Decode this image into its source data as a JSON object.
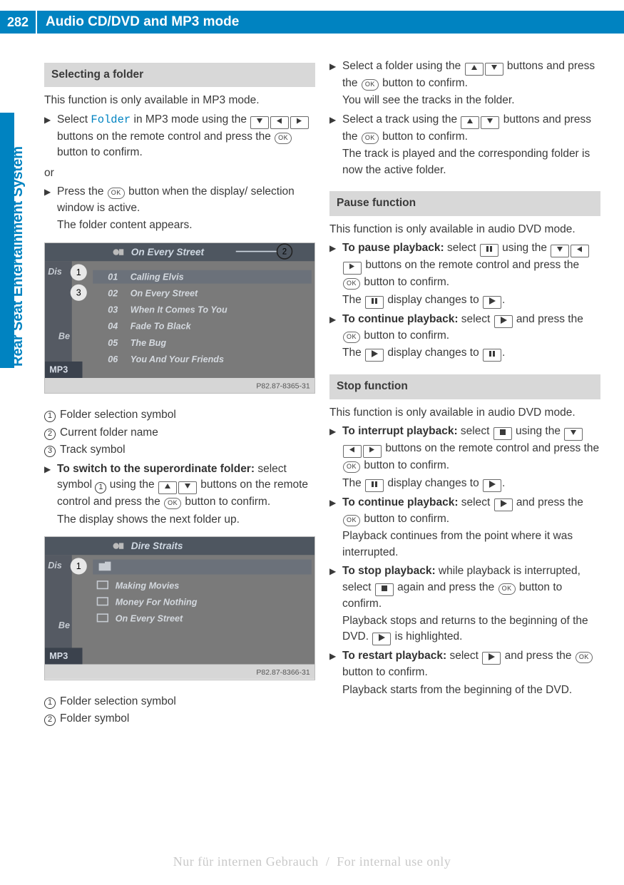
{
  "page_number": "282",
  "header_title": "Audio CD/DVD and MP3 mode",
  "side_tab": "Rear Seat Entertainment System",
  "watermark": "Nur für internen Gebrauch  /  For internal use only",
  "left": {
    "sec1_title": "Selecting a folder",
    "sec1_intro": "This function is only available in MP3 mode.",
    "sec1_step1a": "Select ",
    "sec1_step1_folder": "Folder",
    "sec1_step1b": " in MP3 mode using the ",
    "sec1_step1c": " buttons on the remote control and press the ",
    "sec1_step1d": " button to confirm.",
    "sec1_or": "or",
    "sec1_step2a": "Press the ",
    "sec1_step2b": " button when the display/ selection window is active.",
    "sec1_step2_res": "The folder content appears.",
    "fig1": {
      "header": "On Every Street",
      "disc": "Dis",
      "1": "1",
      "2": "2",
      "3": "3",
      "t01": "01",
      "t01t": "Calling Elvis",
      "t02": "02",
      "t02t": "On Every Street",
      "t03": "03",
      "t03t": "When It Comes To You",
      "t04": "04",
      "t04t": "Fade To Black",
      "t05": "05",
      "t05t": "The Bug",
      "t06": "06",
      "t06t": "You And Your Friends",
      "Be": "Be",
      "MP3": "MP3",
      "code": "P82.87-8365-31"
    },
    "leg1_1": "Folder selection symbol",
    "leg1_2": "Current folder name",
    "leg1_3": "Track symbol",
    "sec1_step3_bold": "To switch to the superordinate folder:",
    "sec1_step3a": " select symbol ",
    "sec1_step3b": " using the ",
    "sec1_step3c": " buttons on the remote control and press the ",
    "sec1_step3d": " button to confirm.",
    "sec1_step3_res": "The display shows the next folder up.",
    "fig2": {
      "header": "Dire Straits",
      "disc": "Dis",
      "1": "1",
      "r1": "Making Movies",
      "r2": "Money For Nothing",
      "r3": "On Every Street",
      "Be": "Be",
      "MP3": "MP3",
      "code": "P82.87-8366-31"
    },
    "leg2_1": "Folder selection symbol",
    "leg2_2": "Folder symbol"
  },
  "right": {
    "r_step1a": "Select a folder using the ",
    "r_step1b": " buttons and press the ",
    "r_step1c": " button to confirm.",
    "r_step1_res": "You will see the tracks in the folder.",
    "r_step2a": "Select a track using the ",
    "r_step2b": " buttons and press the ",
    "r_step2c": " button to confirm.",
    "r_step2_res": "The track is played and the corresponding folder is now the active folder.",
    "sec2_title": "Pause function",
    "sec2_intro": "This function is only available in audio DVD mode.",
    "sec2_s1_bold": "To pause playback:",
    "sec2_s1a": " select ",
    "sec2_s1b": " using the ",
    "sec2_s1c": " buttons on the remote control and press the ",
    "sec2_s1d": " button to confirm.",
    "sec2_s1_res_a": "The ",
    "sec2_s1_res_b": " display changes to ",
    "sec2_s1_res_c": ".",
    "sec2_s2_bold": "To continue playback:",
    "sec2_s2a": " select ",
    "sec2_s2b": " and press the ",
    "sec2_s2c": " button to confirm.",
    "sec2_s2_res_a": "The ",
    "sec2_s2_res_b": " display changes to ",
    "sec2_s2_res_c": ".",
    "sec3_title": "Stop function",
    "sec3_intro": "This function is only available in audio DVD mode.",
    "sec3_s1_bold": "To interrupt playback:",
    "sec3_s1a": " select ",
    "sec3_s1b": " using the ",
    "sec3_s1c": " buttons on the remote control and press the ",
    "sec3_s1d": " button to confirm.",
    "sec3_s1_res_a": "The ",
    "sec3_s1_res_b": " display changes to ",
    "sec3_s1_res_c": ".",
    "sec3_s2_bold": "To continue playback:",
    "sec3_s2a": " select ",
    "sec3_s2b": " and press the ",
    "sec3_s2c": " button to confirm.",
    "sec3_s2_res": "Playback continues from the point where it was interrupted.",
    "sec3_s3_bold": "To stop playback:",
    "sec3_s3a": " while playback is interrupted, select ",
    "sec3_s3b": " again and press the ",
    "sec3_s3c": " button to confirm.",
    "sec3_s3_res_a": "Playback stops and returns to the beginning of the DVD. ",
    "sec3_s3_res_b": " is highlighted.",
    "sec3_s4_bold": "To restart playback:",
    "sec3_s4a": " select ",
    "sec3_s4b": " and press the ",
    "sec3_s4c": " button to confirm.",
    "sec3_s4_res": "Playback starts from the beginning of the DVD."
  }
}
